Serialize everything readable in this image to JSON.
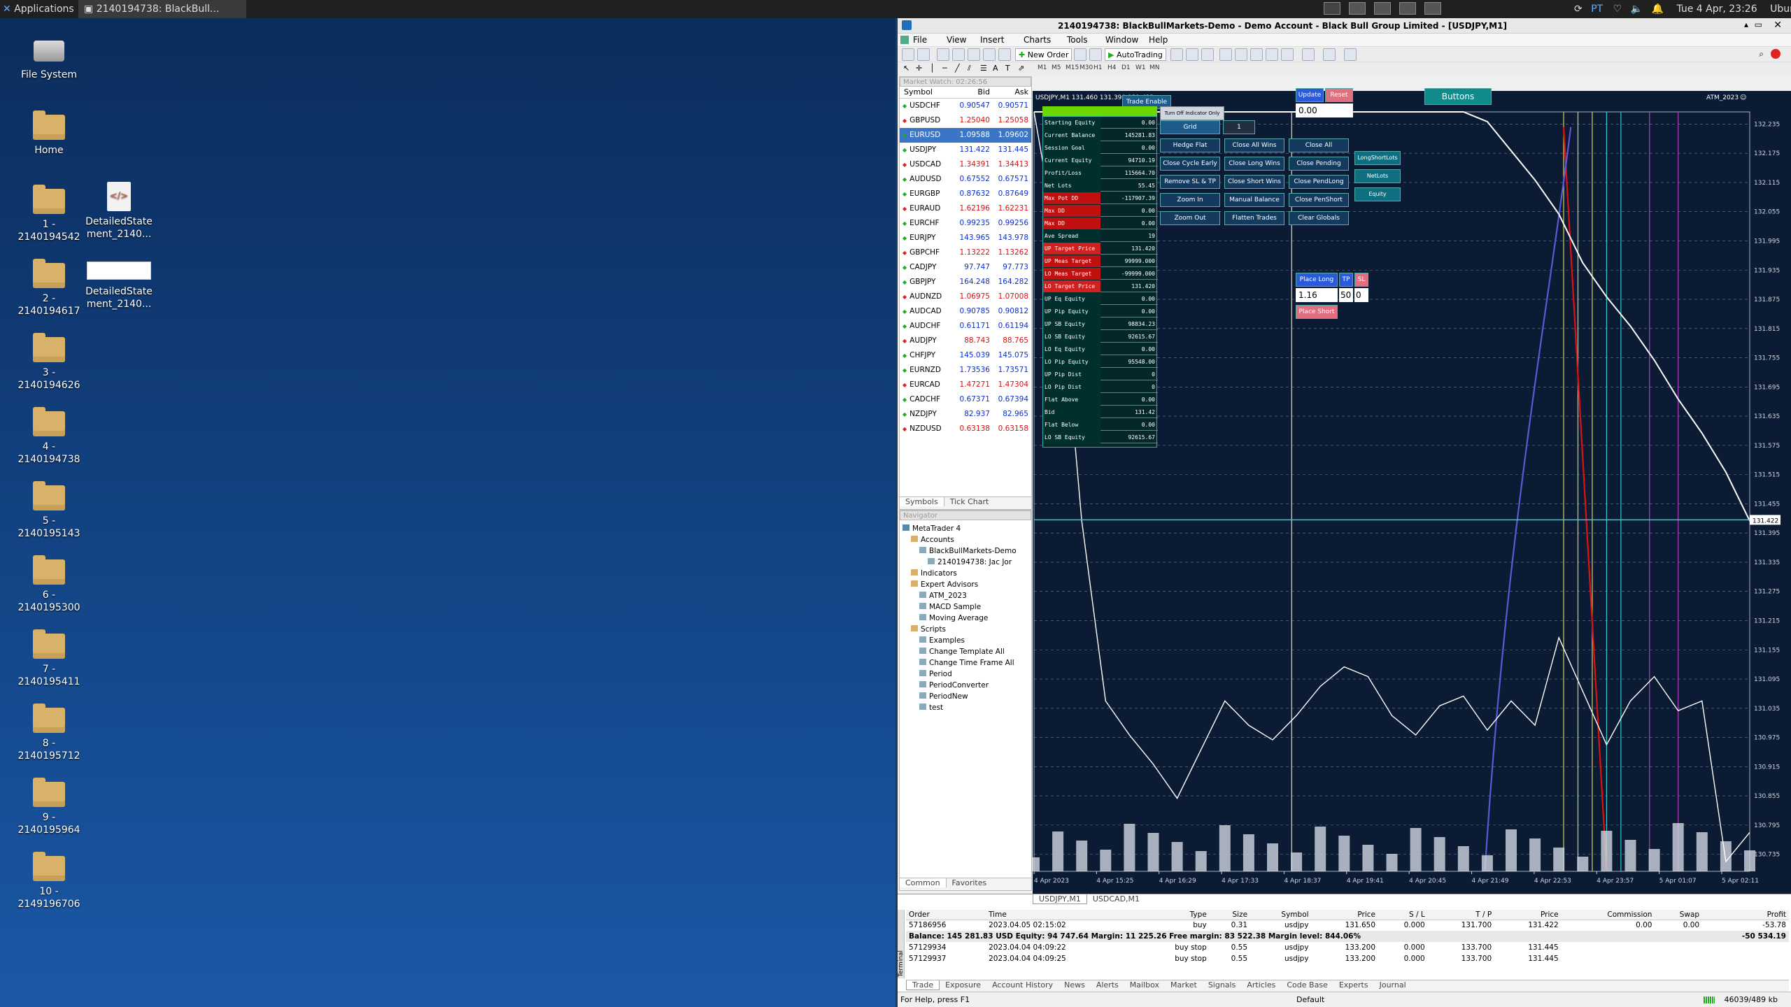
{
  "topbar": {
    "applications": "Applications",
    "task_title": "2140194738: BlackBull...",
    "clock": "Tue 4 Apr, 23:26",
    "user": "Ubuntu",
    "lang": "PT"
  },
  "desktop": {
    "icons": [
      {
        "label": "File System",
        "kind": "drive"
      },
      {
        "label": "Home",
        "kind": "home"
      },
      {
        "label": "1 -\n2140194542",
        "kind": "folder"
      },
      {
        "label": "2 -\n2140194617",
        "kind": "folder"
      },
      {
        "label": "3 -\n2140194626",
        "kind": "folder"
      },
      {
        "label": "4 -\n2140194738",
        "kind": "folder"
      },
      {
        "label": "5 -\n2140195143",
        "kind": "folder"
      },
      {
        "label": "6 -\n2140195300",
        "kind": "folder"
      },
      {
        "label": "7 -\n2140195411",
        "kind": "folder"
      },
      {
        "label": "8 -\n2140195712",
        "kind": "folder"
      },
      {
        "label": "9 -\n2140195964",
        "kind": "folder"
      },
      {
        "label": "10 -\n2149196706",
        "kind": "folder"
      }
    ],
    "files": [
      {
        "label": "DetailedState\nment_2140...",
        "kind": "html-file"
      },
      {
        "label": "DetailedState\nment_2140...",
        "kind": "image-file"
      }
    ]
  },
  "window": {
    "title": "2140194738: BlackBullMarkets-Demo - Demo Account - Black Bull Group Limited - [USDJPY,M1]",
    "menu": [
      "File",
      "View",
      "Insert",
      "Charts",
      "Tools",
      "Window",
      "Help"
    ],
    "new_order": "New Order",
    "autotrading": "AutoTrading",
    "timeframes": [
      "M1",
      "M5",
      "M15",
      "M30",
      "H1",
      "H4",
      "D1",
      "W1",
      "MN"
    ]
  },
  "market_watch": {
    "header": "Market Watch: 02:26:56",
    "columns": [
      "Symbol",
      "Bid",
      "Ask"
    ],
    "rows": [
      {
        "symbol": "USDCHF",
        "bid": "0.90547",
        "ask": "0.90571"
      },
      {
        "symbol": "GBPUSD",
        "bid": "1.25040",
        "ask": "1.25058"
      },
      {
        "symbol": "EURUSD",
        "bid": "1.09588",
        "ask": "1.09602"
      },
      {
        "symbol": "USDJPY",
        "bid": "131.422",
        "ask": "131.445"
      },
      {
        "symbol": "USDCAD",
        "bid": "1.34391",
        "ask": "1.34413"
      },
      {
        "symbol": "AUDUSD",
        "bid": "0.67552",
        "ask": "0.67571"
      },
      {
        "symbol": "EURGBP",
        "bid": "0.87632",
        "ask": "0.87649"
      },
      {
        "symbol": "EURAUD",
        "bid": "1.62196",
        "ask": "1.62231"
      },
      {
        "symbol": "EURCHF",
        "bid": "0.99235",
        "ask": "0.99256"
      },
      {
        "symbol": "EURJPY",
        "bid": "143.965",
        "ask": "143.978"
      },
      {
        "symbol": "GBPCHF",
        "bid": "1.13222",
        "ask": "1.13262"
      },
      {
        "symbol": "CADJPY",
        "bid": "97.747",
        "ask": "97.773"
      },
      {
        "symbol": "GBPJPY",
        "bid": "164.248",
        "ask": "164.282"
      },
      {
        "symbol": "AUDNZD",
        "bid": "1.06975",
        "ask": "1.07008"
      },
      {
        "symbol": "AUDCAD",
        "bid": "0.90785",
        "ask": "0.90812"
      },
      {
        "symbol": "AUDCHF",
        "bid": "0.61171",
        "ask": "0.61194"
      },
      {
        "symbol": "AUDJPY",
        "bid": "88.743",
        "ask": "88.765"
      },
      {
        "symbol": "CHFJPY",
        "bid": "145.039",
        "ask": "145.075"
      },
      {
        "symbol": "EURNZD",
        "bid": "1.73536",
        "ask": "1.73571"
      },
      {
        "symbol": "EURCAD",
        "bid": "1.47271",
        "ask": "1.47304"
      },
      {
        "symbol": "CADCHF",
        "bid": "0.67371",
        "ask": "0.67394"
      },
      {
        "symbol": "NZDJPY",
        "bid": "82.937",
        "ask": "82.965"
      },
      {
        "symbol": "NZDUSD",
        "bid": "0.63138",
        "ask": "0.63158"
      }
    ],
    "tabs": [
      "Symbols",
      "Tick Chart"
    ]
  },
  "navigator": {
    "header": "Navigator",
    "items": [
      {
        "label": "MetaTrader 4",
        "level": 0
      },
      {
        "label": "Accounts",
        "level": 1
      },
      {
        "label": "BlackBullMarkets-Demo",
        "level": 2
      },
      {
        "label": "2140194738: Jac Jor",
        "level": 3
      },
      {
        "label": "Indicators",
        "level": 1
      },
      {
        "label": "Expert Advisors",
        "level": 1
      },
      {
        "label": "ATM_2023",
        "level": 2
      },
      {
        "label": "MACD Sample",
        "level": 2
      },
      {
        "label": "Moving Average",
        "level": 2
      },
      {
        "label": "Scripts",
        "level": 1
      },
      {
        "label": "Examples",
        "level": 2
      },
      {
        "label": "Change Template All",
        "level": 2
      },
      {
        "label": "Change Time Frame All",
        "level": 2
      },
      {
        "label": "Period",
        "level": 2
      },
      {
        "label": "PeriodConverter",
        "level": 2
      },
      {
        "label": "PeriodNew",
        "level": 2
      },
      {
        "label": "test",
        "level": 2
      }
    ],
    "tabs": [
      "Common",
      "Favorites"
    ]
  },
  "chart_data": {
    "type": "line",
    "symbol_header": "USDJPY,M1  131.460 131.390 131.422",
    "expert_label": "ATM_2023",
    "x_ticks": [
      "4 Apr 2023",
      "4 Apr 15:25",
      "4 Apr 16:29",
      "4 Apr 17:33",
      "4 Apr 18:37",
      "4 Apr 19:41",
      "4 Apr 20:45",
      "4 Apr 21:49",
      "4 Apr 22:53",
      "4 Apr 23:57",
      "5 Apr 01:07",
      "5 Apr 02:11"
    ],
    "y_ticks": [
      132.235,
      132.175,
      132.115,
      132.055,
      131.995,
      131.935,
      131.875,
      131.815,
      131.755,
      131.695,
      131.635,
      131.575,
      131.515,
      131.455,
      131.395,
      131.335,
      131.275,
      131.215,
      131.155,
      131.095,
      131.035,
      130.975,
      130.915,
      130.855,
      130.795,
      130.735
    ],
    "ylim": [
      130.7,
      132.26
    ],
    "current_price": 131.422,
    "price_series": [
      132.26,
      131.98,
      131.42,
      131.05,
      130.98,
      130.92,
      130.85,
      130.95,
      131.05,
      131.0,
      130.97,
      131.02,
      131.08,
      131.12,
      131.1,
      131.02,
      130.98,
      131.04,
      131.06,
      130.99,
      131.05,
      131.0,
      131.18,
      131.07,
      130.96,
      131.05,
      131.1,
      131.03,
      131.05,
      130.72,
      130.78
    ],
    "equity_series": [
      132.26,
      132.26,
      132.26,
      132.26,
      132.26,
      132.26,
      132.26,
      132.26,
      132.26,
      132.26,
      132.26,
      132.26,
      132.26,
      132.26,
      132.26,
      132.26,
      132.26,
      132.26,
      132.26,
      132.24,
      132.18,
      132.12,
      132.05,
      131.95,
      131.88,
      131.82,
      131.75,
      131.67,
      131.6,
      131.52,
      131.42
    ],
    "series_colors": {
      "price": "#ffffff",
      "equity": "#ffffff",
      "red_band": "#e01010",
      "blue_band": "#5a5ad8",
      "volume": "#cfd6e0"
    }
  },
  "ea_panel": {
    "trade_enable": "Trade Enable",
    "turn_off": "Turn Off Indicator Only",
    "rows": [
      {
        "label": "Starting Equity",
        "value": "0.00"
      },
      {
        "label": "Current Balance",
        "value": "145281.83"
      },
      {
        "label": "Session Goal",
        "value": "0.00"
      },
      {
        "label": "Current Equity",
        "value": "94710.19"
      },
      {
        "label": "Profit/Loss",
        "value": "115664.70"
      },
      {
        "label": "Net Lots",
        "value": "55.45"
      },
      {
        "label": "Max Pot DD",
        "value": "-117907.39"
      },
      {
        "label": "Max DD",
        "value": "0.00"
      },
      {
        "label": "Max DD",
        "value": "0.00"
      },
      {
        "label": "Ave Spread",
        "value": "19"
      },
      {
        "label": "UP Target Price",
        "value": "131.420"
      },
      {
        "label": "UP Meas Target",
        "value": "99999.000"
      },
      {
        "label": "LO Meas Target",
        "value": "-99999.000"
      },
      {
        "label": "LO Target Price",
        "value": "131.420"
      },
      {
        "label": "UP Eq Equity",
        "value": "0.00"
      },
      {
        "label": "UP Pip Equity",
        "value": "0.00"
      },
      {
        "label": "UP SB Equity",
        "value": "98834.23"
      },
      {
        "label": "LO SB Equity",
        "value": "92615.67"
      },
      {
        "label": "LO Eq Equity",
        "value": "0.00"
      },
      {
        "label": "LO Pip Equity",
        "value": "95548.00"
      },
      {
        "label": "UP Pip Dist",
        "value": "0"
      },
      {
        "label": "LO Pip Dist",
        "value": "0"
      },
      {
        "label": "Flat Above",
        "value": "0.00"
      },
      {
        "label": "Bid",
        "value": "131.42"
      },
      {
        "label": "Flat Below",
        "value": "0.00"
      },
      {
        "label": "LO SB Equity",
        "value": "92615.67"
      }
    ],
    "grid_label": "Grid",
    "grid_value": "1",
    "buttons": [
      [
        "Hedge Flat",
        "Close All Wins",
        "Close All"
      ],
      [
        "Close Cycle Early",
        "Close Long Wins",
        "Close Pending"
      ],
      [
        "Remove SL & TP",
        "Close Short Wins",
        "Close PendLong"
      ],
      [
        "Zoom In",
        "Manual Balance",
        "Close PenShort"
      ],
      [
        "Zoom Out",
        "Flatten Trades",
        "Clear Globals"
      ]
    ],
    "side_buttons": [
      "LongShortLots",
      "NetLots",
      "Equity"
    ],
    "update": "Update",
    "reset": "Reset",
    "input_value": "0.00",
    "buttons_label": "Buttons",
    "place_long": "Place Long",
    "tp": "TP",
    "sl": "SL",
    "lots": "1.16",
    "tp_value": "50",
    "sl_value": "0",
    "place_short": "Place Short"
  },
  "chart_tabs": [
    "USDJPY,M1",
    "USDCAD,M1"
  ],
  "terminal": {
    "columns": [
      "Order",
      "Time",
      "Type",
      "Size",
      "Symbol",
      "Price",
      "S / L",
      "T / P",
      "Price",
      "Commission",
      "Swap",
      "Profit"
    ],
    "rows": [
      [
        "57186956",
        "2023.04.05 02:15:02",
        "buy",
        "0.31",
        "usdjpy",
        "131.650",
        "0.000",
        "131.700",
        "131.422",
        "0.00",
        "0.00",
        "-53.78"
      ],
      [
        "57129934",
        "2023.04.04 04:09:22",
        "buy stop",
        "0.55",
        "usdjpy",
        "133.200",
        "0.000",
        "133.700",
        "131.445",
        "",
        "",
        ""
      ],
      [
        "57129937",
        "2023.04.04 04:09:25",
        "buy stop",
        "0.55",
        "usdjpy",
        "133.200",
        "0.000",
        "133.700",
        "131.445",
        "",
        "",
        ""
      ]
    ],
    "balance_line": "Balance: 145 281.83 USD  Equity: 94 747.64  Margin: 11 225.26  Free margin: 83 522.38  Margin level: 844.06%",
    "balance_total": "-50 534.19",
    "side_label": "Terminal",
    "tabs": [
      "Trade",
      "Exposure",
      "Account History",
      "News",
      "Alerts",
      "Mailbox",
      "Market",
      "Signals",
      "Articles",
      "Code Base",
      "Experts",
      "Journal"
    ]
  },
  "statusbar": {
    "help": "For Help, press F1",
    "profile": "Default",
    "traffic": "46039/489 kb"
  }
}
